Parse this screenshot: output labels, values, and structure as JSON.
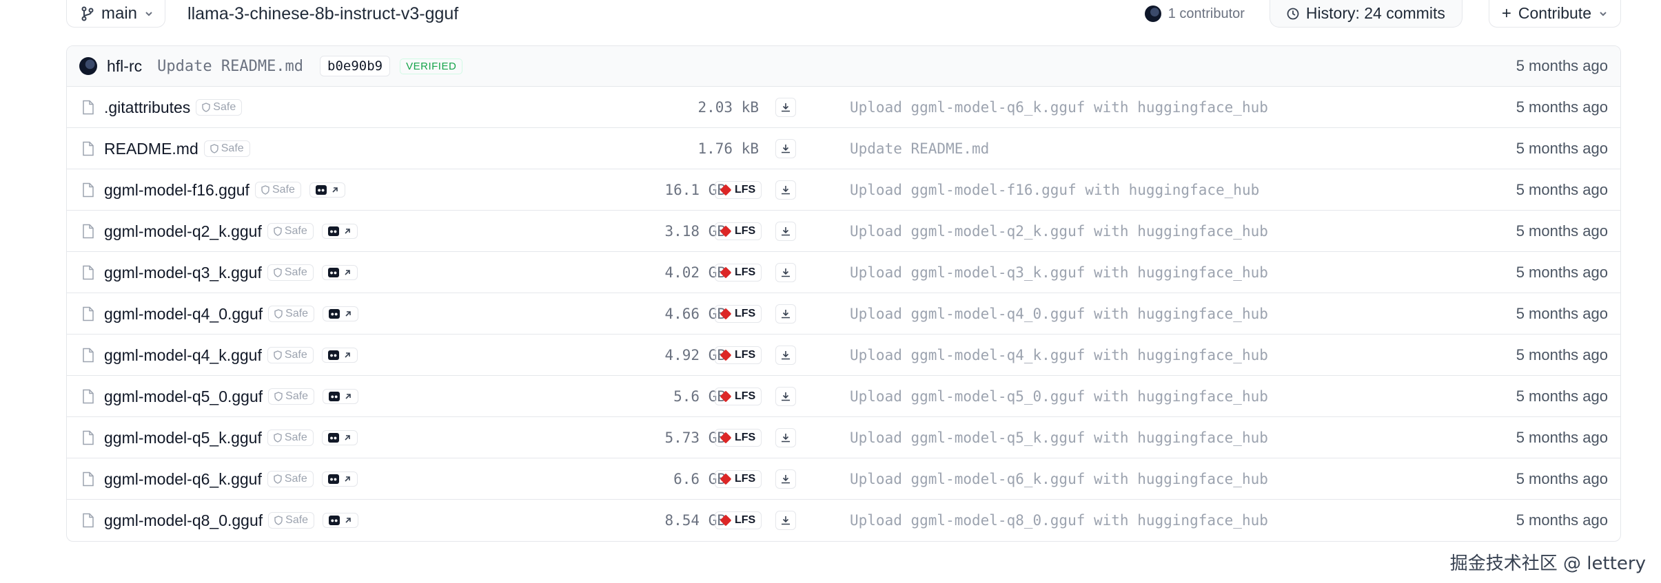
{
  "toolbar": {
    "branch": "main",
    "repo_path": "llama-3-chinese-8b-instruct-v3-gguf",
    "contributors": "1 contributor",
    "history": "History: 24 commits",
    "contribute": "Contribute"
  },
  "last_commit": {
    "author": "hfl-rc",
    "message": "Update README.md",
    "hash": "b0e90b9",
    "verified": "VERIFIED",
    "time": "5 months ago"
  },
  "files": [
    {
      "name": ".gitattributes",
      "safe": "Safe",
      "size": "2.03 kB",
      "lfs": false,
      "commit": "Upload ggml-model-q6_k.gguf with huggingface_hub",
      "time": "5 months ago"
    },
    {
      "name": "README.md",
      "safe": "Safe",
      "size": "1.76 kB",
      "lfs": false,
      "commit": "Update README.md",
      "time": "5 months ago"
    },
    {
      "name": "ggml-model-f16.gguf",
      "safe": "Safe",
      "size": "16.1 GB",
      "lfs": true,
      "commit": "Upload ggml-model-f16.gguf with huggingface_hub",
      "time": "5 months ago"
    },
    {
      "name": "ggml-model-q2_k.gguf",
      "safe": "Safe",
      "size": "3.18 GB",
      "lfs": true,
      "commit": "Upload ggml-model-q2_k.gguf with huggingface_hub",
      "time": "5 months ago"
    },
    {
      "name": "ggml-model-q3_k.gguf",
      "safe": "Safe",
      "size": "4.02 GB",
      "lfs": true,
      "commit": "Upload ggml-model-q3_k.gguf with huggingface_hub",
      "time": "5 months ago"
    },
    {
      "name": "ggml-model-q4_0.gguf",
      "safe": "Safe",
      "size": "4.66 GB",
      "lfs": true,
      "commit": "Upload ggml-model-q4_0.gguf with huggingface_hub",
      "time": "5 months ago"
    },
    {
      "name": "ggml-model-q4_k.gguf",
      "safe": "Safe",
      "size": "4.92 GB",
      "lfs": true,
      "commit": "Upload ggml-model-q4_k.gguf with huggingface_hub",
      "time": "5 months ago"
    },
    {
      "name": "ggml-model-q5_0.gguf",
      "safe": "Safe",
      "size": "5.6 GB",
      "lfs": true,
      "commit": "Upload ggml-model-q5_0.gguf with huggingface_hub",
      "time": "5 months ago"
    },
    {
      "name": "ggml-model-q5_k.gguf",
      "safe": "Safe",
      "size": "5.73 GB",
      "lfs": true,
      "commit": "Upload ggml-model-q5_k.gguf with huggingface_hub",
      "time": "5 months ago"
    },
    {
      "name": "ggml-model-q6_k.gguf",
      "safe": "Safe",
      "size": "6.6 GB",
      "lfs": true,
      "commit": "Upload ggml-model-q6_k.gguf with huggingface_hub",
      "time": "5 months ago"
    },
    {
      "name": "ggml-model-q8_0.gguf",
      "safe": "Safe",
      "size": "8.54 GB",
      "lfs": true,
      "commit": "Upload ggml-model-q8_0.gguf with huggingface_hub",
      "time": "5 months ago"
    }
  ],
  "lfs_label": "LFS",
  "icons": {
    "branch": "git-branch-icon",
    "file": "file-icon",
    "shield": "shield-icon",
    "download": "download-icon",
    "history": "clock-icon",
    "lfs": "lfs-cube-icon"
  },
  "watermark": "掘金技术社区 @ lettery"
}
